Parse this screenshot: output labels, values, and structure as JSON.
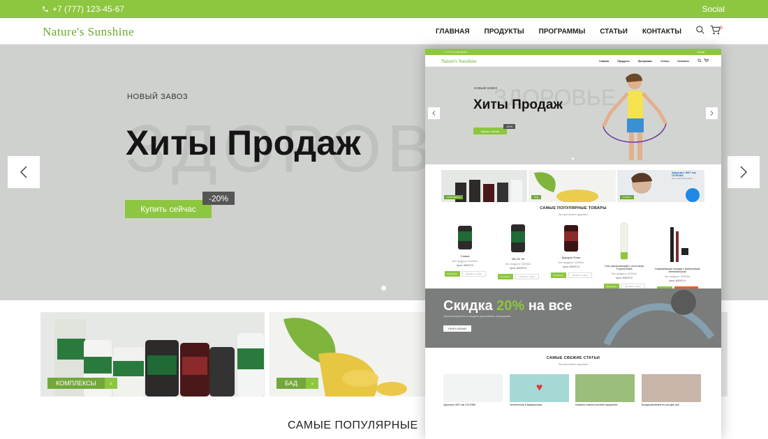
{
  "topbar": {
    "phone": "+7 (777) 123-45-67",
    "social": "Social"
  },
  "header": {
    "logo": "Nature's Sunshine",
    "nav": [
      "ГЛАВНАЯ",
      "ПРОДУКТЫ",
      "ПРОГРАММЫ",
      "СТАТЬИ",
      "КОНТАКТЫ"
    ],
    "cart_count": "0"
  },
  "hero": {
    "eyebrow": "НОВЫЙ ЗАВОЗ",
    "bg_word": "ЗДОРОВЬЕ",
    "title": "Хиты Продаж",
    "buy_label": "Купить сейчас",
    "discount": "-20%"
  },
  "promos": [
    {
      "label": "КОМПЛЕКСЫ"
    },
    {
      "label": "БАД"
    }
  ],
  "section_title": "САМЫЕ ПОПУЛЯРНЫЕ",
  "preview": {
    "phone": "+7 (777) 123-45-67",
    "social": "Social",
    "logo": "Nature's Sunshine",
    "nav": [
      "Главная",
      "Продукты",
      "Программы",
      "Статьи",
      "Контакты"
    ],
    "hero": {
      "eyebrow": "НОВЫЙ ЗАВОЗ",
      "bg_word": "ЗДОРОВЬЕ",
      "title": "Хиты Продаж",
      "buy_label": "Купить сейчас",
      "discount": "-20%"
    },
    "promos": [
      {
        "label": "КОМПЛЕКСЫ"
      },
      {
        "label": "БАД"
      },
      {
        "label": "СТАТЬИ",
        "headline": "Здоровье ЖКТ как ОСНОВА",
        "subtext": "или стартовый набор"
      }
    ],
    "popular_title": "САМЫЕ ПОПУЛЯРНЫЕ ТОВАРЫ",
    "popular_sub": "Все для вашего здоровья",
    "products": [
      {
        "name": "Стевия",
        "weight": "Вес продукта: 100000м",
        "price": "Цена: 3500РСН",
        "btn1": "В корзину",
        "btn2": "Добавить товар"
      },
      {
        "name": "Эйч Эс Эн",
        "weight": "Вес продукта: 100000м",
        "price": "Цена: 8000РСН",
        "btn1": "В корзину",
        "btn2": "Добавить товар"
      },
      {
        "name": "Бургурин Плюс",
        "weight": "Вес продукта: 100000м",
        "price": "Цена: 8000РСН",
        "btn1": "В корзину",
        "btn2": "Добавить товар"
      },
      {
        "name": "Гель увлажняющий с алоэ вера Tropical Mists",
        "weight": "Вес продукта: 100000м",
        "price": "Цена: 8000РСН",
        "btn1": "В корзину",
        "btn2": "Добавить товар"
      },
      {
        "name": "Ухаживающая помада с фиброевым аппликатором",
        "weight": "Вес продукта: 100000м",
        "price": "Цена: 8000РСН",
        "btn1": "В корзину",
        "btn2": "Добавить товар"
      }
    ],
    "sale": {
      "title_prefix": "Скидка ",
      "title_accent": "20%",
      "title_suffix": " на все",
      "subtext": "Зарегистрируйтесь и следуйте дальнейшим инструкциям",
      "button": "УЗНАТЬ БОЛЬШЕ"
    },
    "articles_title": "САМЫЕ СВЕЖИЕ СТАТЬИ",
    "articles_sub": "Все для вашего здоровья",
    "articles": [
      {
        "caption": "Здоровье ЖКТ как ОСНОВА"
      },
      {
        "caption": "Питательная и медицинская"
      },
      {
        "caption": "Назвали главное условие продления"
      },
      {
        "caption": "Выздоравливаем на раз-два-три!"
      }
    ]
  },
  "colors": {
    "accent": "#8dc63f",
    "accent_dark": "#72a83a",
    "hero_bg": "#cfd1ce",
    "discount_bg": "#555555",
    "sale_bg": "#7b7c7c"
  },
  "icons": [
    "phone-icon",
    "search-icon",
    "cart-icon",
    "chevron-left-icon",
    "chevron-right-icon"
  ]
}
